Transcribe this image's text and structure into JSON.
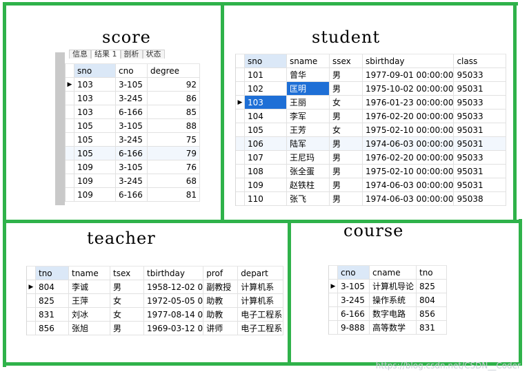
{
  "panels": {
    "score": {
      "title": "score"
    },
    "student": {
      "title": "student"
    },
    "teacher": {
      "title": "teacher"
    },
    "course": {
      "title": "course"
    }
  },
  "score_tabs": [
    "信息",
    "结果 1",
    "剖析",
    "状态"
  ],
  "score": {
    "columns": [
      "sno",
      "cno",
      "degree"
    ],
    "rows": [
      [
        "103",
        "3-105",
        "92"
      ],
      [
        "103",
        "3-245",
        "86"
      ],
      [
        "103",
        "6-166",
        "85"
      ],
      [
        "105",
        "3-105",
        "88"
      ],
      [
        "105",
        "3-245",
        "75"
      ],
      [
        "105",
        "6-166",
        "79"
      ],
      [
        "109",
        "3-105",
        "76"
      ],
      [
        "109",
        "3-245",
        "68"
      ],
      [
        "109",
        "6-166",
        "81"
      ]
    ]
  },
  "student": {
    "columns": [
      "sno",
      "sname",
      "ssex",
      "sbirthday",
      "class"
    ],
    "rows": [
      [
        "101",
        "曾华",
        "男",
        "1977-09-01 00:00:00",
        "95033"
      ],
      [
        "102",
        "匡明",
        "男",
        "1975-10-02 00:00:00",
        "95031"
      ],
      [
        "103",
        "王丽",
        "女",
        "1976-01-23 00:00:00",
        "95033"
      ],
      [
        "104",
        "李军",
        "男",
        "1976-02-20 00:00:00",
        "95033"
      ],
      [
        "105",
        "王芳",
        "女",
        "1975-02-10 00:00:00",
        "95031"
      ],
      [
        "106",
        "陆军",
        "男",
        "1974-06-03 00:00:00",
        "95031"
      ],
      [
        "107",
        "王尼玛",
        "男",
        "1976-02-20 00:00:00",
        "95033"
      ],
      [
        "108",
        "张全蛋",
        "男",
        "1975-02-10 00:00:00",
        "95031"
      ],
      [
        "109",
        "赵铁柱",
        "男",
        "1974-06-03 00:00:00",
        "95031"
      ],
      [
        "110",
        "张飞",
        "男",
        "1974-06-03 00:00:00",
        "95038"
      ]
    ]
  },
  "teacher": {
    "columns": [
      "tno",
      "tname",
      "tsex",
      "tbirthday",
      "prof",
      "depart"
    ],
    "rows": [
      [
        "804",
        "李诚",
        "男",
        "1958-12-02 0",
        "副教授",
        "计算机系"
      ],
      [
        "825",
        "王萍",
        "女",
        "1972-05-05 0",
        "助教",
        "计算机系"
      ],
      [
        "831",
        "刘冰",
        "女",
        "1977-08-14 0",
        "助教",
        "电子工程系"
      ],
      [
        "856",
        "张旭",
        "男",
        "1969-03-12 0",
        "讲师",
        "电子工程系"
      ]
    ]
  },
  "course": {
    "columns": [
      "cno",
      "cname",
      "tno"
    ],
    "rows": [
      [
        "3-105",
        "计算机导论",
        "825"
      ],
      [
        "3-245",
        "操作系统",
        "804"
      ],
      [
        "6-166",
        "数字电路",
        "856"
      ],
      [
        "9-888",
        "高等数学",
        "831"
      ]
    ]
  },
  "watermark": "https://blog.csdn.net/CSDN__Coder",
  "colors": {
    "border_green": "#2fb24a",
    "selection_blue": "#1e6fd6",
    "header_highlight": "#dbe8f7"
  }
}
